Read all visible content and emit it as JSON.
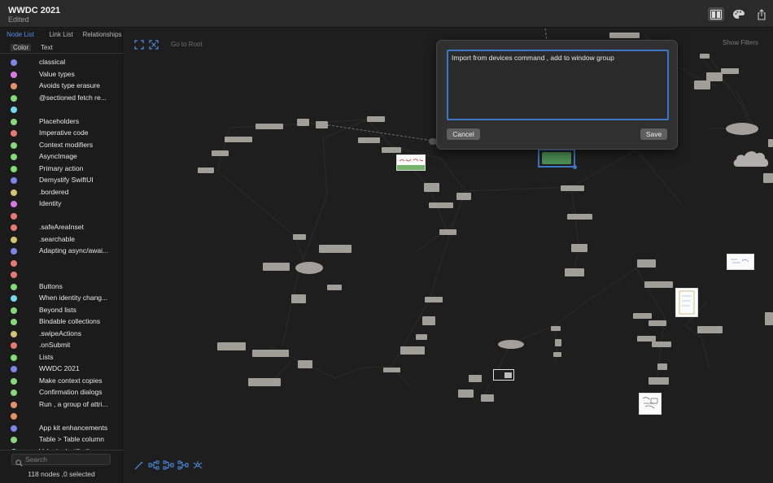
{
  "window": {
    "title": "WWDC 2021",
    "subtitle": "Edited"
  },
  "sidebar": {
    "tabs": [
      "Node List",
      "Link List",
      "Relationships"
    ],
    "columns": {
      "color": "Color",
      "text": "Text"
    },
    "rows": [
      {
        "color": "#7b86e8",
        "text": "classical"
      },
      {
        "color": "#d47ae0",
        "text": "Value types"
      },
      {
        "color": "#e2916b",
        "text": "Avoids type erasure"
      },
      {
        "color": "#84da78",
        "text": "@sectioned fetch re..."
      },
      {
        "color": "#74d8ee",
        "text": ""
      },
      {
        "color": "#84da78",
        "text": "Placeholders"
      },
      {
        "color": "#e57a72",
        "text": "Imperative code"
      },
      {
        "color": "#84da78",
        "text": "Context modifiers"
      },
      {
        "color": "#84da78",
        "text": "AsyncImage"
      },
      {
        "color": "#84da78",
        "text": "Primary action"
      },
      {
        "color": "#7b86e8",
        "text": "Demystify SwiftUI"
      },
      {
        "color": "#d4c26e",
        "text": ".bordered"
      },
      {
        "color": "#d47ae0",
        "text": "Identity"
      },
      {
        "color": "#e57a72",
        "text": ""
      },
      {
        "color": "#e57a72",
        "text": ".safeAreaInset"
      },
      {
        "color": "#d4c26e",
        "text": ".searchable"
      },
      {
        "color": "#7b86e8",
        "text": "Adapting async/awai..."
      },
      {
        "color": "#e57a72",
        "text": ""
      },
      {
        "color": "#e57a72",
        "text": ""
      },
      {
        "color": "#84da78",
        "text": "Buttons"
      },
      {
        "color": "#74d8ee",
        "text": "When identity chang..."
      },
      {
        "color": "#84da78",
        "text": "Beyond lists"
      },
      {
        "color": "#84da78",
        "text": "Bindable collections"
      },
      {
        "color": "#d4c26e",
        "text": ".swipeActions"
      },
      {
        "color": "#e57a72",
        "text": ".onSubmit"
      },
      {
        "color": "#84da78",
        "text": "Lists"
      },
      {
        "color": "#7b86e8",
        "text": "WWDC 2021"
      },
      {
        "color": "#84da78",
        "text": "Make context copies"
      },
      {
        "color": "#84da78",
        "text": "Confirmation dialogs"
      },
      {
        "color": "#e2916b",
        "text": "Run , a group of attri..."
      },
      {
        "color": "#e2916b",
        "text": ""
      },
      {
        "color": "#7b86e8",
        "text": "App kit enhancements"
      },
      {
        "color": "#84da78",
        "text": "Table  > Table column"
      },
      {
        "color": "#74d8ee",
        "text": "Valueinobutifiodi..."
      }
    ],
    "search_placeholder": "Search",
    "status": "118 nodes ,0 selected"
  },
  "canvas": {
    "go_to_root": "Go to Root",
    "show_filters": "Show Filters",
    "editor": {
      "text": "Import from devices command , add to window group",
      "cancel": "Cancel",
      "save": "Save"
    }
  },
  "icons": {
    "toolbar": [
      "layout-panels-icon",
      "palette-icon",
      "share-icon"
    ],
    "canvas_top": [
      "fit-all-icon",
      "fit-selection-icon"
    ],
    "canvas_bottom": [
      "magic-wand-icon",
      "horizontal-layout-icon",
      "tree-layout-icon",
      "tree-layout-alt-icon",
      "star-layout-icon"
    ]
  },
  "colors": {
    "accent": "#4f8fe8",
    "selected_node": "#3d76c5",
    "canvas": "#1e1e1e"
  }
}
